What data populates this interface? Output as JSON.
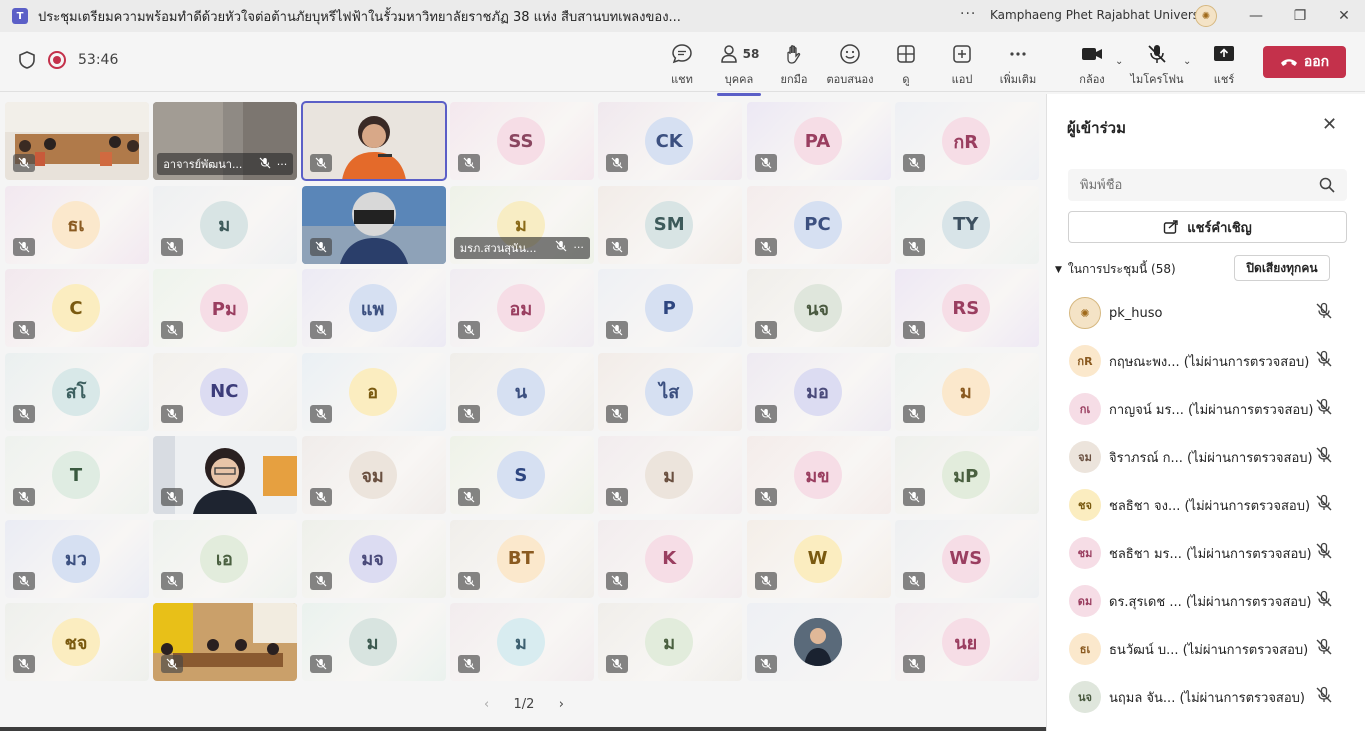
{
  "window": {
    "title": "ประชุมเตรียมความพร้อมทำดีด้วยหัวใจต่อต้านภัยบุหรีไฟฟ้าในรั้วมหาวิทยาลัยราชภัฏ 38 แห่ง สืบสานบทเพลงของ...",
    "more": "···",
    "org": "Kamphaeng Phet Rajabhat University"
  },
  "toolbar": {
    "timer": "53:46",
    "chat": "แชท",
    "people": "บุคคล",
    "people_count": "58",
    "raise": "ยกมือ",
    "react": "ตอบสนอง",
    "view": "ดู",
    "apps": "แอป",
    "more": "เพิ่มเติม",
    "camera": "กล้อง",
    "mic": "ไมโครโฟน",
    "share": "แชร์",
    "leave": "ออก"
  },
  "tiles": [
    {
      "type": "video",
      "scene": "meeting-room",
      "color": "#b07a4a"
    },
    {
      "type": "video",
      "scene": "blurred",
      "color": "#8a8580",
      "name": "อาจารย์พัฒนา..."
    },
    {
      "type": "video",
      "scene": "speaker",
      "color": "#d9c8b8",
      "selected": true
    },
    {
      "type": "avatar",
      "initials": "SS",
      "bg": "#f6dde6",
      "fg": "#8a4660",
      "tint": "#f4e8ee"
    },
    {
      "type": "avatar",
      "initials": "CK",
      "bg": "#d6e0f2",
      "fg": "#3c5080",
      "tint": "#f0e8ee"
    },
    {
      "type": "avatar",
      "initials": "PA",
      "bg": "#f6dde6",
      "fg": "#9a3e60",
      "tint": "#ece8f4"
    },
    {
      "type": "avatar",
      "initials": "กR",
      "bg": "#f6dde6",
      "fg": "#9a3e60",
      "tint": "#eef0f4"
    },
    {
      "type": "avatar",
      "initials": "ธเ",
      "bg": "#fbe8cc",
      "fg": "#8a5a20",
      "tint": "#f2e8f0"
    },
    {
      "type": "avatar",
      "initials": "ม",
      "bg": "#d8e4e4",
      "fg": "#3d5a5a",
      "tint": "#eef0f2"
    },
    {
      "type": "video",
      "scene": "helmet",
      "color": "#5a86b8"
    },
    {
      "type": "avatar",
      "initials": "ม",
      "bg": "#f8edc4",
      "fg": "#8a6a18",
      "tint": "#eef2e8",
      "name": "มรภ.สวนสุนัน..."
    },
    {
      "type": "avatar",
      "initials": "SM",
      "bg": "#d8e4e4",
      "fg": "#3d5a5a",
      "tint": "#f2ece8"
    },
    {
      "type": "avatar",
      "initials": "PC",
      "bg": "#d6e0f2",
      "fg": "#3c5080",
      "tint": "#f4ecec"
    },
    {
      "type": "avatar",
      "initials": "TY",
      "bg": "#d8e4e8",
      "fg": "#3d5060",
      "tint": "#eef2f0"
    },
    {
      "type": "avatar",
      "initials": "C",
      "bg": "#fbedc0",
      "fg": "#7a5a10",
      "tint": "#f2e8ee"
    },
    {
      "type": "avatar",
      "initials": "Pม",
      "bg": "#f6dde6",
      "fg": "#9a3e60",
      "tint": "#eef4ec"
    },
    {
      "type": "avatar",
      "initials": "แพ",
      "bg": "#d6e0f2",
      "fg": "#3c5080",
      "tint": "#eceaf4"
    },
    {
      "type": "avatar",
      "initials": "อม",
      "bg": "#f6dde6",
      "fg": "#9a3e60",
      "tint": "#f0ecf2"
    },
    {
      "type": "avatar",
      "initials": "P",
      "bg": "#d6e0f2",
      "fg": "#2e4680",
      "tint": "#eef0f4"
    },
    {
      "type": "avatar",
      "initials": "นจ",
      "bg": "#dfe6dc",
      "fg": "#4a5a40",
      "tint": "#f0eeea"
    },
    {
      "type": "avatar",
      "initials": "RS",
      "bg": "#f6dde6",
      "fg": "#9a3e60",
      "tint": "#eee8f4"
    },
    {
      "type": "avatar",
      "initials": "สโ",
      "bg": "#d8e8e8",
      "fg": "#3d6060",
      "tint": "#eaf0f0"
    },
    {
      "type": "avatar",
      "initials": "NC",
      "bg": "#dcdcf2",
      "fg": "#3c3c7a",
      "tint": "#f2f0ec"
    },
    {
      "type": "avatar",
      "initials": "อ",
      "bg": "#fbedc0",
      "fg": "#7a5a10",
      "tint": "#eaf0f4"
    },
    {
      "type": "avatar",
      "initials": "น",
      "bg": "#d6e0f2",
      "fg": "#3c5080",
      "tint": "#f0eeea"
    },
    {
      "type": "avatar",
      "initials": "ไส",
      "bg": "#d6e0f2",
      "fg": "#3c5080",
      "tint": "#f2ece8"
    },
    {
      "type": "avatar",
      "initials": "มอ",
      "bg": "#dcdcf2",
      "fg": "#4a4a7a",
      "tint": "#eeeaf2"
    },
    {
      "type": "avatar",
      "initials": "ม",
      "bg": "#fbe8cc",
      "fg": "#8a5a20",
      "tint": "#eef2f0"
    },
    {
      "type": "avatar",
      "initials": "T",
      "bg": "#dfece2",
      "fg": "#3a5a40",
      "tint": "#eef2ee"
    },
    {
      "type": "video",
      "scene": "woman",
      "color": "#e8ecf0"
    },
    {
      "type": "avatar",
      "initials": "จม",
      "bg": "#ece4dc",
      "fg": "#6a5040",
      "tint": "#f0ecea"
    },
    {
      "type": "avatar",
      "initials": "S",
      "bg": "#d6e0f2",
      "fg": "#2e4680",
      "tint": "#eef2e8"
    },
    {
      "type": "avatar",
      "initials": "ม",
      "bg": "#ece4dc",
      "fg": "#6a5040",
      "tint": "#f2ecee"
    },
    {
      "type": "avatar",
      "initials": "มข",
      "bg": "#f6dde6",
      "fg": "#9a3e60",
      "tint": "#f4ecea"
    },
    {
      "type": "avatar",
      "initials": "มP",
      "bg": "#e2ecdc",
      "fg": "#4a6040",
      "tint": "#eef0ec"
    },
    {
      "type": "avatar",
      "initials": "มว",
      "bg": "#d6e0f2",
      "fg": "#3c5080",
      "tint": "#eaecf4"
    },
    {
      "type": "avatar",
      "initials": "เอ",
      "bg": "#e2ecdc",
      "fg": "#4a6040",
      "tint": "#eef2ee"
    },
    {
      "type": "avatar",
      "initials": "มจ",
      "bg": "#dcdcf2",
      "fg": "#4a4a7a",
      "tint": "#eef0ea"
    },
    {
      "type": "avatar",
      "initials": "BT",
      "bg": "#fbe8cc",
      "fg": "#8a5a20",
      "tint": "#f0eeea"
    },
    {
      "type": "avatar",
      "initials": "K",
      "bg": "#f6dde6",
      "fg": "#9a3e60",
      "tint": "#f2ecee"
    },
    {
      "type": "avatar",
      "initials": "W",
      "bg": "#fbedc0",
      "fg": "#7a5a10",
      "tint": "#f4eee8"
    },
    {
      "type": "avatar",
      "initials": "WS",
      "bg": "#f6dde6",
      "fg": "#9a3e60",
      "tint": "#eef0f2"
    },
    {
      "type": "avatar",
      "initials": "ชจ",
      "bg": "#fbedc0",
      "fg": "#7a5a10",
      "tint": "#eef0ec"
    },
    {
      "type": "video",
      "scene": "group-room",
      "color": "#7a5a3a"
    },
    {
      "type": "avatar",
      "initials": "ม",
      "bg": "#d8e4e0",
      "fg": "#3d5a50",
      "tint": "#eaf2ee"
    },
    {
      "type": "avatar",
      "initials": "ม",
      "bg": "#d8ecf0",
      "fg": "#3d6070",
      "tint": "#f2ecee"
    },
    {
      "type": "avatar",
      "initials": "ม",
      "bg": "#e2ecdc",
      "fg": "#4a6040",
      "tint": "#f0eeea"
    },
    {
      "type": "photo-avatar",
      "bg": "#4a5a6a",
      "tint": "#eef0f4"
    },
    {
      "type": "avatar",
      "initials": "นย",
      "bg": "#f6dde6",
      "fg": "#9a3e60",
      "tint": "#f2ecf0"
    }
  ],
  "pager": {
    "label": "1/2"
  },
  "panel": {
    "title": "ผู้เข้าร่วม",
    "search_placeholder": "พิมพ์ชื่อ",
    "invite": "แชร์คำเชิญ",
    "section": "ในการประชุมนี้ (58)",
    "mute_all": "ปิดเสียงทุกคน",
    "participants": [
      {
        "initials": "",
        "name": "pk_huso",
        "bg": "#f4e3c6",
        "fg": "#a06a1a",
        "logo": true
      },
      {
        "initials": "กR",
        "name": "กฤษณะพง... (ไม่ผ่านการตรวจสอบ)",
        "bg": "#fbe8cc",
        "fg": "#8a5a20"
      },
      {
        "initials": "กเ",
        "name": "กาญจน์ มร... (ไม่ผ่านการตรวจสอบ)",
        "bg": "#f6dde6",
        "fg": "#9a3e60"
      },
      {
        "initials": "จม",
        "name": "จิราภรณ์ ก... (ไม่ผ่านการตรวจสอบ)",
        "bg": "#ece4dc",
        "fg": "#6a5040"
      },
      {
        "initials": "ชจ",
        "name": "ชลธิชา จง... (ไม่ผ่านการตรวจสอบ)",
        "bg": "#fbedc0",
        "fg": "#7a5a10"
      },
      {
        "initials": "ชม",
        "name": "ชลธิชา มร... (ไม่ผ่านการตรวจสอบ)",
        "bg": "#f6dde6",
        "fg": "#9a3e60"
      },
      {
        "initials": "ดม",
        "name": "ดร.สุรเดช ... (ไม่ผ่านการตรวจสอบ)",
        "bg": "#f6dde6",
        "fg": "#9a3e60"
      },
      {
        "initials": "ธเ",
        "name": "ธนวัฒน์ บ... (ไม่ผ่านการตรวจสอบ)",
        "bg": "#fbe8cc",
        "fg": "#8a5a20"
      },
      {
        "initials": "นจ",
        "name": "นฤมล จัน... (ไม่ผ่านการตรวจสอบ)",
        "bg": "#dfe6dc",
        "fg": "#4a5a40"
      }
    ]
  },
  "colors": {
    "accent": "#5b5fc7",
    "leave": "#c4314b"
  }
}
